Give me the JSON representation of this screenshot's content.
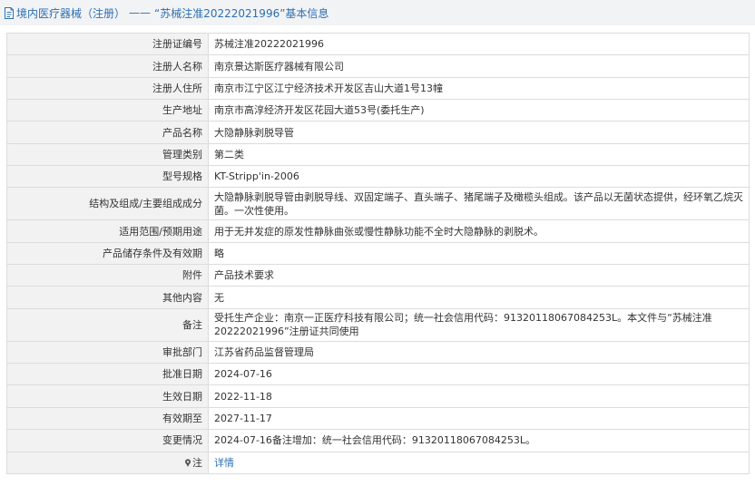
{
  "header": {
    "title": "境内医疗器械（注册）",
    "separator": "——",
    "subtitle": "“苏械注准20222021996”基本信息"
  },
  "rows": [
    {
      "label": "注册证编号",
      "value": "苏械注准20222021996"
    },
    {
      "label": "注册人名称",
      "value": "南京景达斯医疗器械有限公司"
    },
    {
      "label": "注册人住所",
      "value": "南京市江宁区江宁经济技术开发区吉山大道1号13幢"
    },
    {
      "label": "生产地址",
      "value": "南京市高淳经济开发区花园大道53号(委托生产)"
    },
    {
      "label": "产品名称",
      "value": "大隐静脉剥脱导管"
    },
    {
      "label": "管理类别",
      "value": "第二类"
    },
    {
      "label": "型号规格",
      "value": "KT-Stripp'in-2006"
    },
    {
      "label": "结构及组成/主要组成成分",
      "value": "大隐静脉剥脱导管由剥脱导线、双固定端子、直头端子、猪尾端子及橄榄头组成。该产品以无菌状态提供，经环氧乙烷灭菌。一次性使用。"
    },
    {
      "label": "适用范围/预期用途",
      "value": "用于无并发症的原发性静脉曲张或慢性静脉功能不全时大隐静脉的剥脱术。"
    },
    {
      "label": "产品储存条件及有效期",
      "value": "略"
    },
    {
      "label": "附件",
      "value": "产品技术要求"
    },
    {
      "label": "其他内容",
      "value": "无"
    },
    {
      "label": "备注",
      "value": "受托生产企业：南京一正医疗科技有限公司；统一社会信用代码：91320118067084253L。本文件与“苏械注准20222021996”注册证共同使用"
    },
    {
      "label": "审批部门",
      "value": "江苏省药品监督管理局"
    },
    {
      "label": "批准日期",
      "value": "2024-07-16"
    },
    {
      "label": "生效日期",
      "value": "2022-11-18"
    },
    {
      "label": "有效期至",
      "value": "2027-11-17"
    },
    {
      "label": "变更情况",
      "value": "2024-07-16备注增加：统一社会信用代码：91320118067084253L。"
    }
  ],
  "note_row": {
    "label": "注",
    "link": "详情",
    "icon": "pin-icon"
  }
}
